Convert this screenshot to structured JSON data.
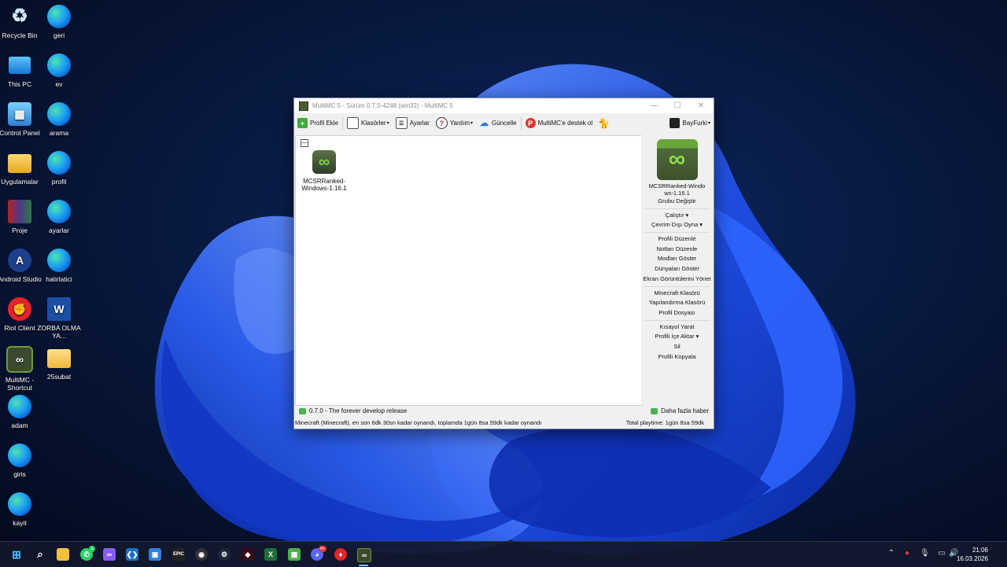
{
  "desktop": {
    "icons_col1": [
      {
        "label": "Recycle Bin",
        "icon": "recycle-bin-icon"
      },
      {
        "label": "This PC",
        "icon": "pc-icon"
      },
      {
        "label": "Control Panel",
        "icon": "control-panel-icon"
      },
      {
        "label": "Uygulamalar",
        "icon": "folder-icon"
      },
      {
        "label": "Proje",
        "icon": "winrar-icon"
      },
      {
        "label": "Android Studio",
        "icon": "android-studio-icon"
      },
      {
        "label": "Riot Client",
        "icon": "riot-client-icon"
      },
      {
        "label": "MultiMC - Shortcut",
        "icon": "multimc-icon"
      },
      {
        "label": "adam",
        "icon": "edge-icon"
      },
      {
        "label": "giris",
        "icon": "edge-icon"
      },
      {
        "label": "kayit",
        "icon": "edge-icon"
      }
    ],
    "icons_col2": [
      {
        "label": "geri",
        "icon": "edge-icon"
      },
      {
        "label": "ev",
        "icon": "edge-icon"
      },
      {
        "label": "arama",
        "icon": "edge-icon"
      },
      {
        "label": "profil",
        "icon": "edge-icon"
      },
      {
        "label": "ayarlar",
        "icon": "edge-icon"
      },
      {
        "label": "hatirlatici",
        "icon": "edge-icon"
      },
      {
        "label": "ZORBA OLMA YA...",
        "icon": "document-icon"
      },
      {
        "label": "25subat",
        "icon": "folder-icon"
      }
    ]
  },
  "window": {
    "title": "MultiMC 5 - Sürüm 0.7.0-4248 (win32) - MultiMC 5",
    "controls": {
      "minimize": "—",
      "maximize": "☐",
      "close": "✕"
    },
    "toolbar": {
      "add_profile": "Profil Ekle",
      "folders": "Klasörler",
      "settings": "Ayarlar",
      "help": "Yardım",
      "update": "Güncelle",
      "support": "MultiMC'e destek ol",
      "account": "BayFurki"
    },
    "instance": {
      "name": "MCSRRanked-Windows-1.16.1",
      "collapse": "—"
    },
    "sidebar": {
      "name": "MCSRRanked-Windows-1.16.1",
      "change_group": "Grubu Değiştir",
      "launch": "Çalıştır",
      "launch_offline": "Çevrim Dışı Oyna",
      "edit_instance": "Profili Düzenle",
      "edit_notes": "Notları Düzenle",
      "view_mods": "Modları Göster",
      "view_worlds": "Dünyaları Göster",
      "manage_screenshots": "Ekran Görüntülerini Yönet",
      "minecraft_folder": "Minecraft Klasörü",
      "config_folder": "Yapılandırma Klasörü",
      "instance_folder": "Profil Dosyası",
      "create_shortcut": "Kısayol Yarat",
      "export": "Profili İçe Aktar",
      "delete": "Sil",
      "copy": "Profili Kopyala"
    },
    "news": {
      "latest": "0.7.0 - The forever develop release",
      "more": "Daha fazla haber"
    },
    "status": {
      "left": "Minecraft  (Minecraft), en son 6dk 30sn kadar oynandı, toplamda 1gün 8sa 59dk kadar oynandı",
      "right": "Total playtime: 1gün 8sa 59dk"
    }
  },
  "taskbar": {
    "time": "21:06",
    "date": "16.03.2026",
    "whatsapp_badge": "1",
    "discord_badge": "9+"
  },
  "colors": {
    "wallpaper_bg": "#06112e",
    "bloom": "#1f5cff",
    "taskbar": "#12182c"
  }
}
